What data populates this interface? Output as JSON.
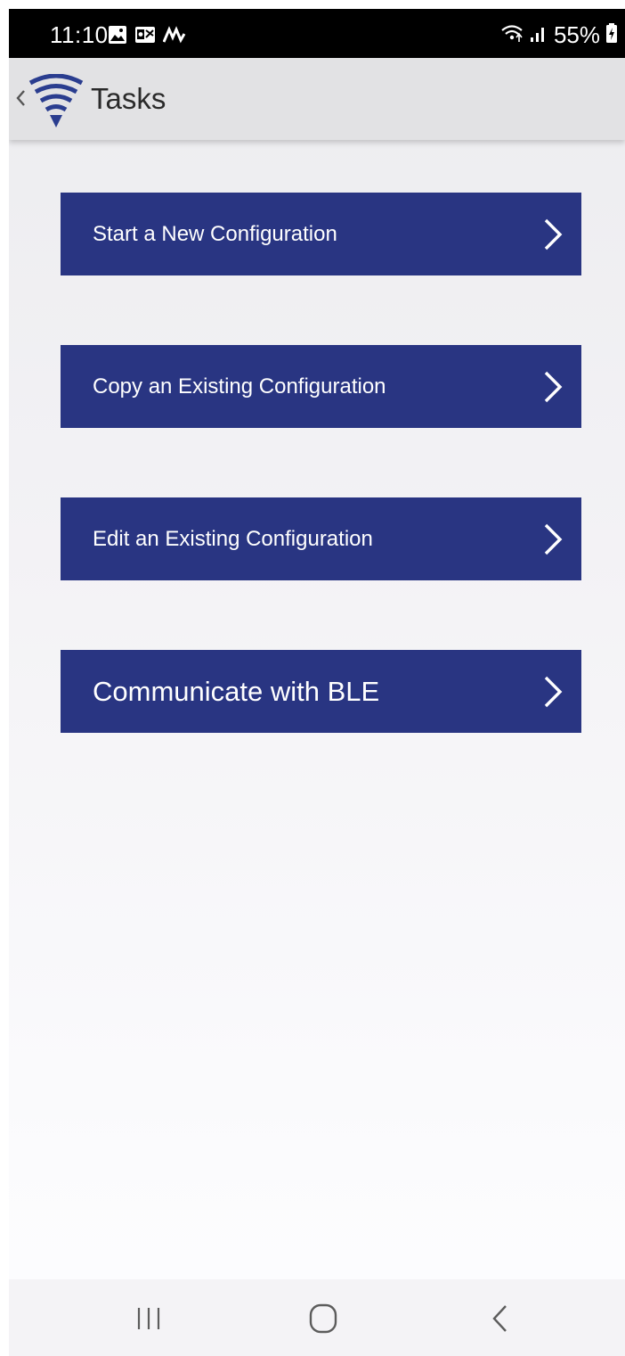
{
  "status_bar": {
    "time": "11:10",
    "battery_percent": "55%",
    "left_icons": [
      "gallery-icon",
      "outlook-icon",
      "activity-icon"
    ],
    "right_icons": [
      "wifi-icon",
      "signal-icon",
      "battery-icon"
    ]
  },
  "app_bar": {
    "title": "Tasks",
    "logo_icon": "signal-funnel-logo",
    "back_icon": "chevron-left-icon"
  },
  "tasks": [
    {
      "label": "Start a New Configuration"
    },
    {
      "label": "Copy an Existing Configuration"
    },
    {
      "label": "Edit an Existing Configuration"
    },
    {
      "label": "Communicate with BLE"
    }
  ],
  "nav_bar": {
    "items": [
      "recents-icon",
      "home-icon",
      "back-icon"
    ]
  },
  "colors": {
    "button_background": "#293582",
    "button_text": "#ffffff",
    "app_bar_background": "#e2e2e4",
    "logo_blue": "#2a3d8f"
  }
}
